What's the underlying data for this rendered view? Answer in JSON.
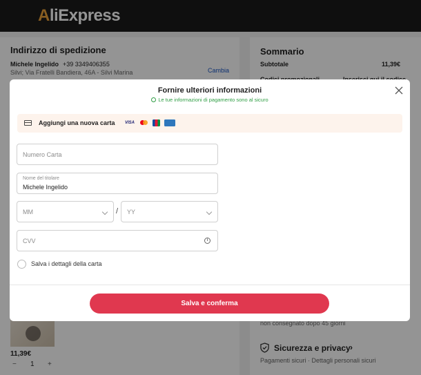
{
  "brand": {
    "logo_first": "A",
    "logo_rest": "liExpress",
    "accent_color": "#e8a13a",
    "cta_color": "#e0384f"
  },
  "shipping": {
    "title": "Indirizzo di spedizione",
    "name": "Michele Ingelido",
    "phone": "+39 3349406355",
    "address": "Silvi; Via Fratelli Bandiera, 46A - Silvi Marina",
    "change_label": "Cambia"
  },
  "summary": {
    "title": "Sommario",
    "subtotal_label": "Subtotale",
    "subtotal_value": "11,39€",
    "promo_label": "Codici promozionali",
    "promo_action": "Inserisci qui il codice"
  },
  "item": {
    "price": "11,39€",
    "quantity": "1",
    "minus": "−",
    "plus": "+"
  },
  "guarantee": {
    "note": "non consegnato dopo 45 giorni"
  },
  "security": {
    "title": "Sicurezza e privacy",
    "arrow": "›",
    "subtitle": "Pagamenti sicuri · Dettagli personali sicuri"
  },
  "modal": {
    "title": "Fornire ulteriori informazioni",
    "secure_note": "Le tue informazioni di pagamento sono al sicuro",
    "close_icon": "close-icon",
    "card_banner": {
      "label": "Aggiungi una nuova carta",
      "brands": [
        "VISA",
        "Mastercard",
        "JCB",
        "American Express"
      ],
      "visa_text": "VISA"
    },
    "fields": {
      "card_number_placeholder": "Numero Carta",
      "holder_label": "Nome del titolare",
      "holder_value": "Michele Ingelido",
      "month_placeholder": "MM",
      "year_placeholder": "YY",
      "separator": "/",
      "cvv_placeholder": "CVV",
      "info_glyph": "i"
    },
    "save_details_label": "Salva i dettagli della carta",
    "submit_label": "Salva e conferma"
  }
}
